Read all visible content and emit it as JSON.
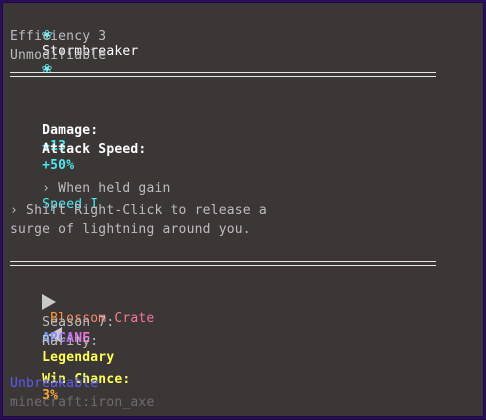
{
  "item": {
    "name": "Stormbreaker",
    "enchant": "Efficiency 3",
    "modifiable": "Unmodifiable"
  },
  "stats": {
    "damage_label": "Damage:",
    "damage_value": "+13",
    "speed_label": "Attack Speed:",
    "speed_value": "+50%"
  },
  "abilities": {
    "held_prefix": "› When held gain",
    "held_effect": "Speed I",
    "shift_line1": "› Shift Right-Click to release a",
    "shift_line2": "surge of lightning around you."
  },
  "crate": {
    "title": "Blossom Crate",
    "season_label": "Season 7:",
    "season_value": "ARCANE",
    "rarity_label": "Rarity:",
    "rarity_value": "Legendary",
    "win_label": "Win Chance:",
    "win_value": "3%"
  },
  "footer": {
    "unbreakable": "Unbreakable",
    "item_id": "minecraft:iron_axe"
  },
  "colors": {
    "background": "#3b3737",
    "border": "#2a0d5c",
    "cyan": "#4de8f0",
    "yellow": "#ffff55",
    "blue": "#5a5cf2",
    "orange": "#ffaa33"
  },
  "icons": {
    "blossom": "blossom-icon",
    "arrow_right": "triangle-right-icon",
    "arrow_left": "triangle-left-icon"
  }
}
